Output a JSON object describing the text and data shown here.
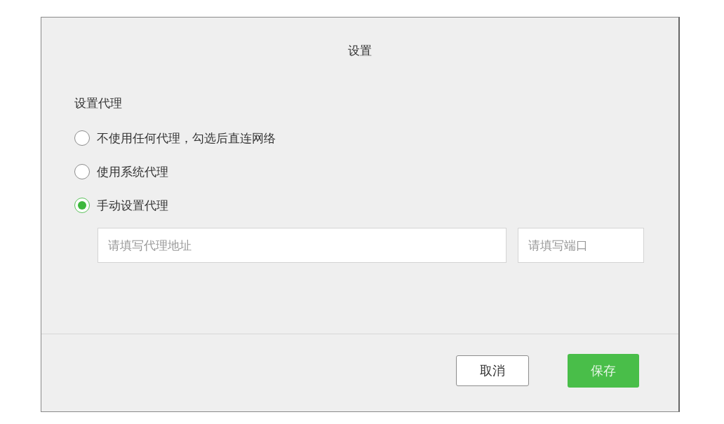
{
  "dialog": {
    "title": "设置",
    "section_label": "设置代理",
    "options": [
      {
        "label": "不使用任何代理，勾选后直连网络",
        "selected": false
      },
      {
        "label": "使用系统代理",
        "selected": false
      },
      {
        "label": "手动设置代理",
        "selected": true
      }
    ],
    "address_field": {
      "placeholder": "请填写代理地址"
    },
    "port_field": {
      "placeholder": "请填写端口"
    },
    "buttons": [
      {
        "label": "取消",
        "kind": "secondary"
      },
      {
        "label": "保存",
        "kind": "primary"
      }
    ]
  }
}
